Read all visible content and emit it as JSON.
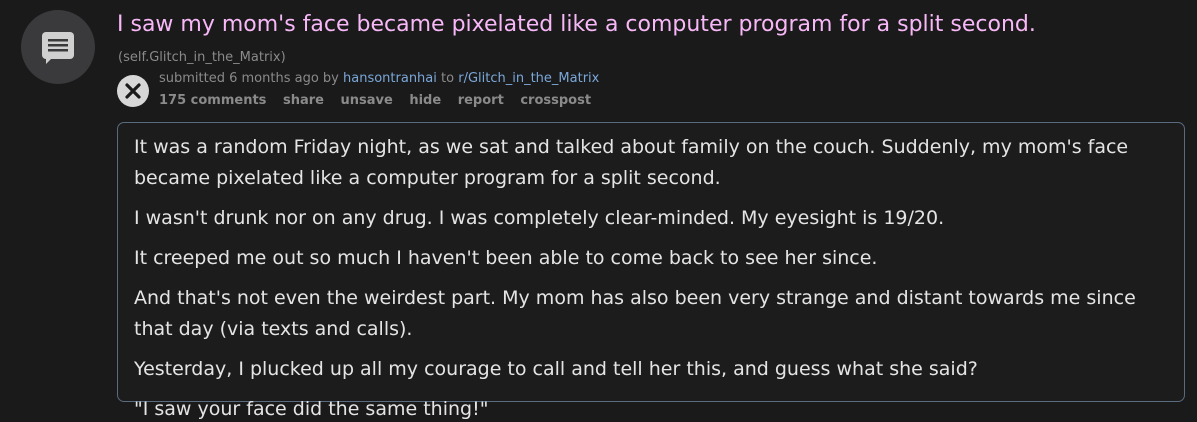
{
  "post": {
    "title": "I saw my mom's face became pixelated like a computer program for a split second.",
    "domain": "(self.Glitch_in_the_Matrix)",
    "tagline": {
      "prefix": "submitted 6 months ago by ",
      "author": "hansontranhai",
      "middle": " to ",
      "subreddit": "r/Glitch_in_the_Matrix"
    },
    "buttons": {
      "comments": "175 comments",
      "share": "share",
      "unsave": "unsave",
      "hide": "hide",
      "report": "report",
      "crosspost": "crosspost"
    },
    "thumbnail_icon": "self-post-icon",
    "close_icon": "close-icon",
    "paragraphs": [
      "It was a random Friday night, as we sat and talked about family on the couch. Suddenly, my mom's face became pixelated like a computer program for a split second.",
      "I wasn't drunk nor on any drug. I was completely clear-minded. My eyesight is 19/20.",
      "It creeped me out so much I haven't been able to come back to see her since.",
      "And that's not even the weirdest part. My mom has also been very strange and distant towards me since that day (via texts and calls).",
      "Yesterday, I plucked up all my courage to call and tell her this, and guess what she said?",
      "\"I saw your face did the same thing!\""
    ],
    "colors": {
      "title": "#f8b8f8",
      "link": "#7aa7d8",
      "background": "#1a1a1b",
      "border": "#5a6a7f"
    }
  }
}
